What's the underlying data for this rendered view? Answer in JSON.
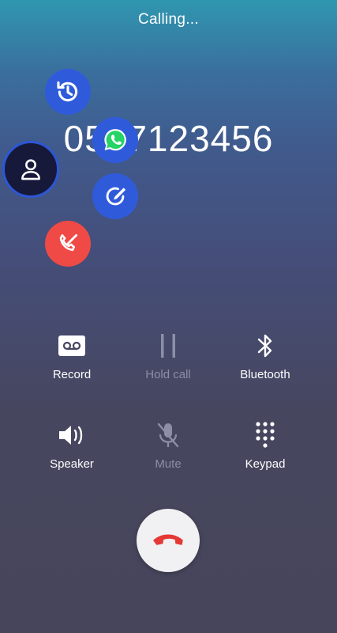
{
  "call": {
    "status": "Calling...",
    "number": "0597123456"
  },
  "floating_actions": {
    "history": "history-icon",
    "whatsapp": "whatsapp-icon",
    "contact": "person-icon",
    "edit": "edit-icon",
    "block": "block-call-icon"
  },
  "controls": {
    "record": "Record",
    "hold": "Hold call",
    "bluetooth": "Bluetooth",
    "speaker": "Speaker",
    "mute": "Mute",
    "keypad": "Keypad"
  },
  "colors": {
    "accent_blue": "#2f5bdb",
    "danger_red": "#ef4a45",
    "end_call_icon": "#e53935"
  }
}
